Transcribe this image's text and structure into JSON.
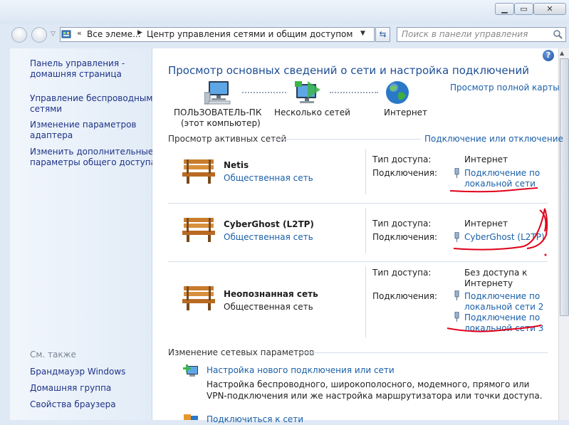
{
  "window": {
    "min_label": "▁",
    "max_label": "▭",
    "close_label": "✕"
  },
  "address": {
    "chevron": "«",
    "crumb1": "Все элеме...",
    "crumb2": "Центр управления сетями и общим доступом"
  },
  "search": {
    "placeholder": "Поиск в панели управления"
  },
  "sidebar": {
    "items": [
      {
        "label": "Панель управления -\nдомашняя страница"
      },
      {
        "label": "Управление беспроводными\nсетями"
      },
      {
        "label": "Изменение параметров\nадаптера"
      },
      {
        "label": "Изменить дополнительные\nпараметры общего доступа"
      }
    ],
    "see_also_title": "См. также",
    "see_also": [
      {
        "label": "Брандмауэр Windows"
      },
      {
        "label": "Домашняя группа"
      },
      {
        "label": "Свойства браузера"
      }
    ]
  },
  "main": {
    "help": "?",
    "title": "Просмотр основных сведений о сети и настройка подключений",
    "full_map_link": "Просмотр полной карты",
    "map": {
      "computer": "ПОЛЬЗОВАТЕЛЬ-ПК",
      "computer_sub": "(этот компьютер)",
      "networks": "Несколько сетей",
      "internet": "Интернет"
    },
    "active_header": "Просмотр активных сетей",
    "connect_link": "Подключение или отключение",
    "access_type_label": "Тип доступа:",
    "connections_label": "Подключения:",
    "networks": [
      {
        "name": "Netis",
        "type": "Общественная сеть",
        "access": "Интернет",
        "connections": [
          "Подключение по\nлокальной сети"
        ]
      },
      {
        "name": "CyberGhost (L2TP)",
        "type": "Общественная сеть",
        "access": "Интернет",
        "connections": [
          "CyberGhost (L2TP)"
        ]
      },
      {
        "name": "Неопознанная сеть",
        "type": "Общественная сеть",
        "access": "Без доступа к\nИнтернету",
        "connections": [
          "Подключение по\nлокальной сети 2",
          "Подключение по\nлокальной сети 3"
        ]
      }
    ],
    "change_header": "Изменение сетевых параметров",
    "tasks": [
      {
        "link": "Настройка нового подключения или сети",
        "desc": "Настройка беспроводного, широкополосного, модемного, прямого или\nVPN-подключения или же настройка маршрутизатора или точки доступа."
      },
      {
        "link": "Подключиться к сети"
      }
    ]
  },
  "colors": {
    "link": "#1a5fa8",
    "annotation": "#e0001a"
  }
}
